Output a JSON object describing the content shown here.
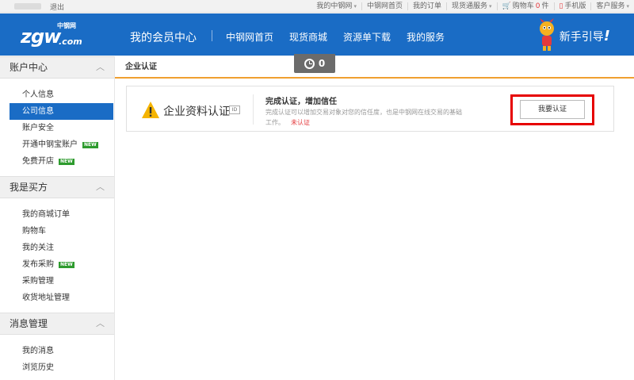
{
  "topbar": {
    "logout": "退出",
    "links": [
      {
        "label": "我的中钢网",
        "caret": true
      },
      {
        "label": "中钢网首页",
        "caret": false
      },
      {
        "label": "我的订单",
        "caret": false
      },
      {
        "label": "现货通服务",
        "caret": true
      },
      {
        "label": "购物车",
        "count": "0",
        "unit": "件",
        "icon": "cart-icon"
      },
      {
        "label": "手机版",
        "icon": "phone-icon"
      },
      {
        "label": "客户服务",
        "caret": true
      }
    ]
  },
  "header": {
    "logo_main": "zgw",
    "logo_cn": "中钢网",
    "logo_com": ".com",
    "member_center": "我的会员中心",
    "nav": [
      "中钢网首页",
      "现货商城",
      "资源单下载",
      "我的服务"
    ],
    "guide": "新手引导",
    "guide_bang": "!"
  },
  "sidebar": {
    "sections": [
      {
        "title": "账户中心",
        "items": [
          {
            "label": "个人信息",
            "active": false,
            "new": false
          },
          {
            "label": "公司信息",
            "active": true,
            "new": false
          },
          {
            "label": "账户安全",
            "active": false,
            "new": false
          },
          {
            "label": "开通中钢宝账户",
            "active": false,
            "new": true
          },
          {
            "label": "免费开店",
            "active": false,
            "new": true
          }
        ]
      },
      {
        "title": "我是买方",
        "items": [
          {
            "label": "我的商城订单",
            "active": false,
            "new": false
          },
          {
            "label": "购物车",
            "active": false,
            "new": false
          },
          {
            "label": "我的关注",
            "active": false,
            "new": false
          },
          {
            "label": "发布采购",
            "active": false,
            "new": true
          },
          {
            "label": "采购管理",
            "active": false,
            "new": false
          },
          {
            "label": "收货地址管理",
            "active": false,
            "new": false
          }
        ]
      },
      {
        "title": "消息管理",
        "items": [
          {
            "label": "我的消息",
            "active": false,
            "new": false
          },
          {
            "label": "浏览历史",
            "active": false,
            "new": false
          }
        ]
      }
    ],
    "new_badge": "NEW"
  },
  "main": {
    "title": "企业认证",
    "timer_value": "0",
    "card": {
      "title": "企业资料认证",
      "doc_icon_text": "ID",
      "headline": "完成认证，增加信任",
      "desc": "完成认证可以增加交易对象对您的信任度，也是中钢网在线交易的基础工作。",
      "status": "未认证",
      "button": "我要认证"
    }
  },
  "colors": {
    "brand_blue": "#1a6cc5",
    "accent_orange": "#f0a030",
    "alert_red": "#e60000",
    "new_green": "#2e9b2e"
  }
}
